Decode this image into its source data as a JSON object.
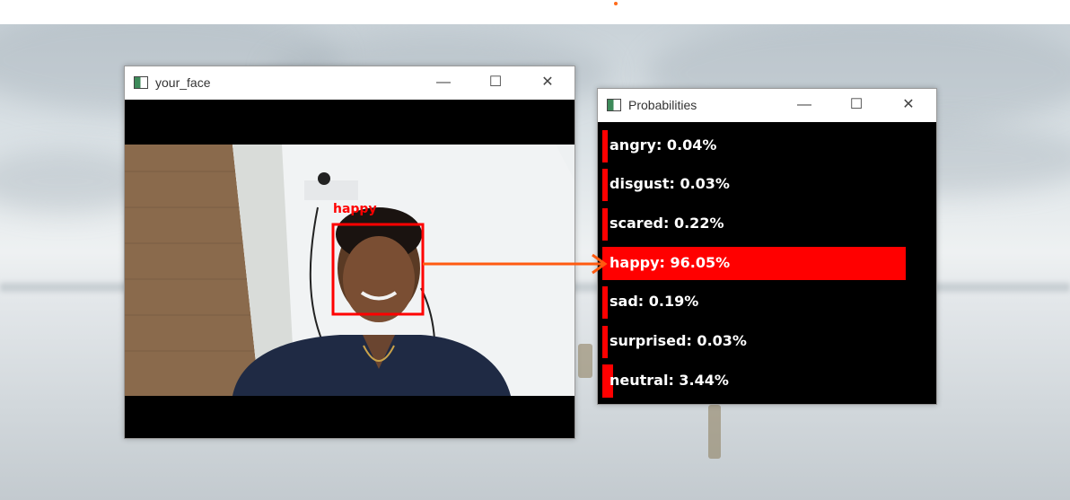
{
  "windows": {
    "face": {
      "title": "your_face",
      "detected_label": "happy"
    },
    "probabilities": {
      "title": "Probabilities"
    }
  },
  "controls": {
    "minimize": "—",
    "maximize": "☐",
    "close": "✕"
  },
  "emotions": [
    {
      "label": "angry: 0.04%",
      "probability": 0.04
    },
    {
      "label": "disgust: 0.03%",
      "probability": 0.03
    },
    {
      "label": "scared: 0.22%",
      "probability": 0.22
    },
    {
      "label": "happy: 96.05%",
      "probability": 96.05
    },
    {
      "label": "sad: 0.19%",
      "probability": 0.19
    },
    {
      "label": "surprised: 0.03%",
      "probability": 0.03
    },
    {
      "label": "neutral: 3.44%",
      "probability": 3.44
    }
  ],
  "colors": {
    "bar": "#ff0000",
    "face_box": "#ff0000",
    "arrow": "#ff5a10"
  }
}
